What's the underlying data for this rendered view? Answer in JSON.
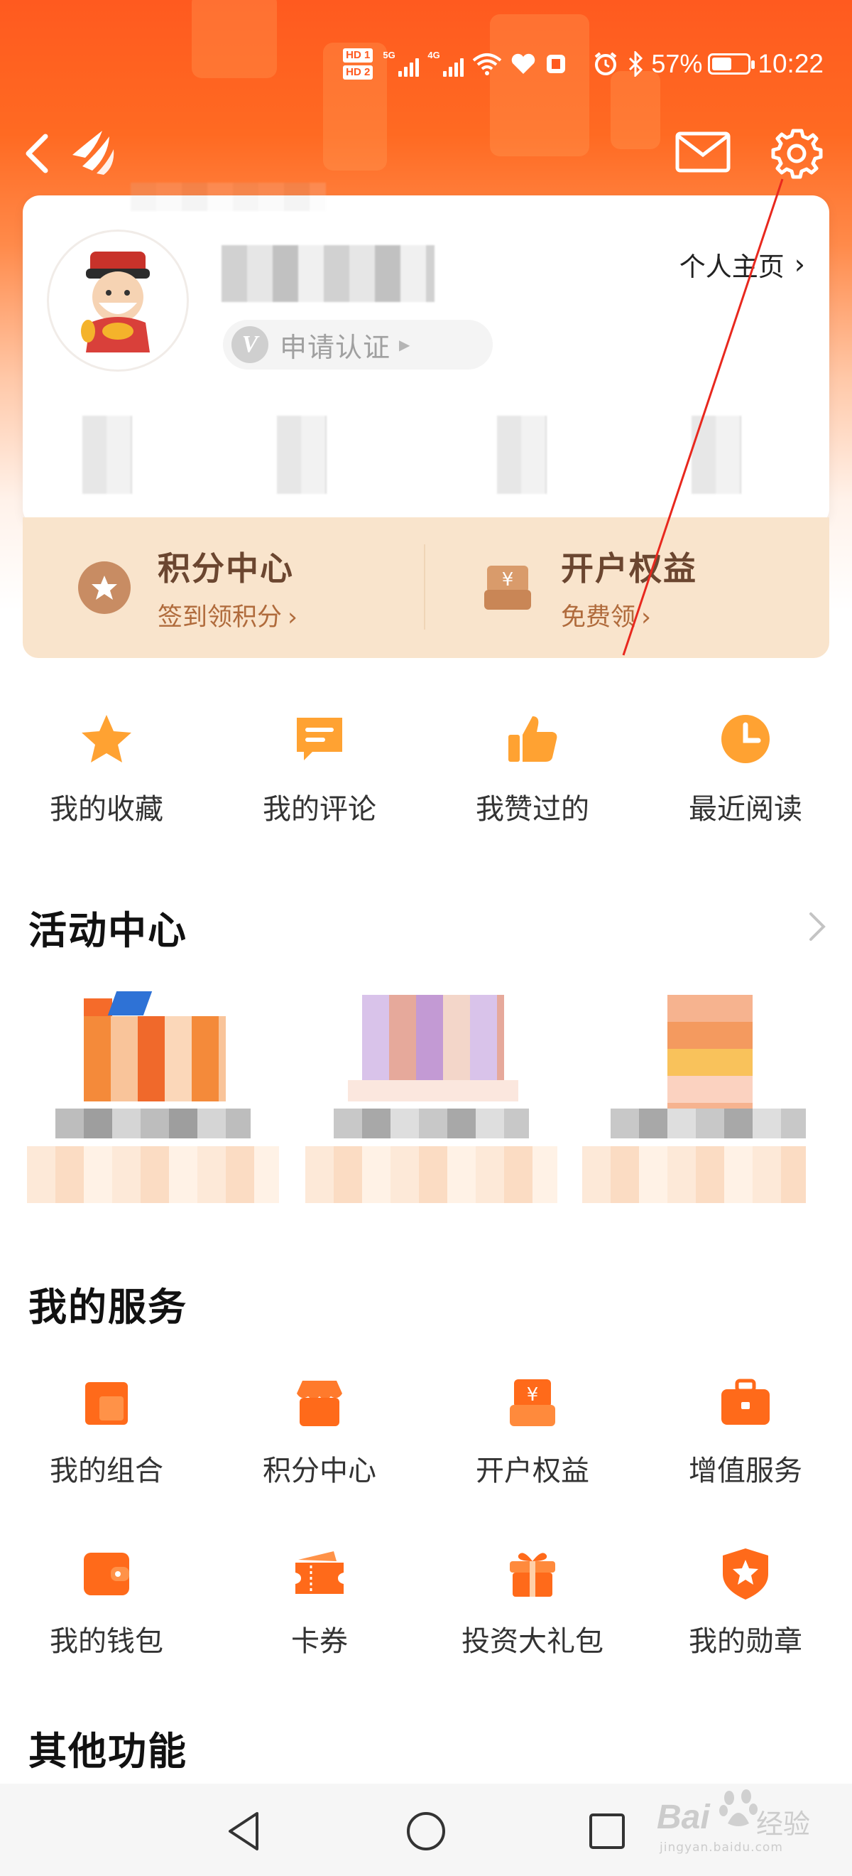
{
  "status_bar": {
    "hd_badges": [
      "HD 1",
      "HD 2"
    ],
    "network_1": "5G",
    "network_2": "4G",
    "battery_percent": "57%",
    "battery_level": 0.57,
    "time": "10:22"
  },
  "header": {
    "back_icon": "chevron-left-icon",
    "logo_icon": "app-logo-icon",
    "mail_icon": "mail-icon",
    "settings_icon": "gear-icon"
  },
  "profile": {
    "avatar_icon": "caishen-avatar",
    "verify_label": "申请认证",
    "verify_badge": "V",
    "home_link": "个人主页",
    "chev": "›"
  },
  "points_strip": {
    "left_title": "积分中心",
    "left_sub": "签到领积分",
    "right_title": "开户权益",
    "right_sub": "免费领",
    "chev": "›"
  },
  "quick_actions": [
    {
      "label": "我的收藏",
      "icon": "star-icon"
    },
    {
      "label": "我的评论",
      "icon": "comment-icon"
    },
    {
      "label": "我赞过的",
      "icon": "thumbs-up-icon"
    },
    {
      "label": "最近阅读",
      "icon": "clock-icon"
    }
  ],
  "activity": {
    "title": "活动中心"
  },
  "services": {
    "title": "我的服务",
    "row1": [
      {
        "label": "我的组合",
        "icon": "portfolio-icon"
      },
      {
        "label": "积分中心",
        "icon": "shop-icon"
      },
      {
        "label": "开户权益",
        "icon": "yuan-box-icon"
      },
      {
        "label": "增值服务",
        "icon": "briefcase-icon"
      }
    ],
    "row2": [
      {
        "label": "我的钱包",
        "icon": "wallet-icon"
      },
      {
        "label": "卡券",
        "icon": "ticket-icon"
      },
      {
        "label": "投资大礼包",
        "icon": "gift-icon"
      },
      {
        "label": "我的勋章",
        "icon": "medal-icon"
      }
    ]
  },
  "other": {
    "title": "其他功能"
  },
  "watermark": {
    "brand": "Bai",
    "brand_cn": "经验",
    "url": "jingyan.baidu.com"
  },
  "colors": {
    "brand_orange": "#ff5a1f",
    "icon_orange": "#ff6a1a",
    "points_bg": "#f9e4cc"
  }
}
